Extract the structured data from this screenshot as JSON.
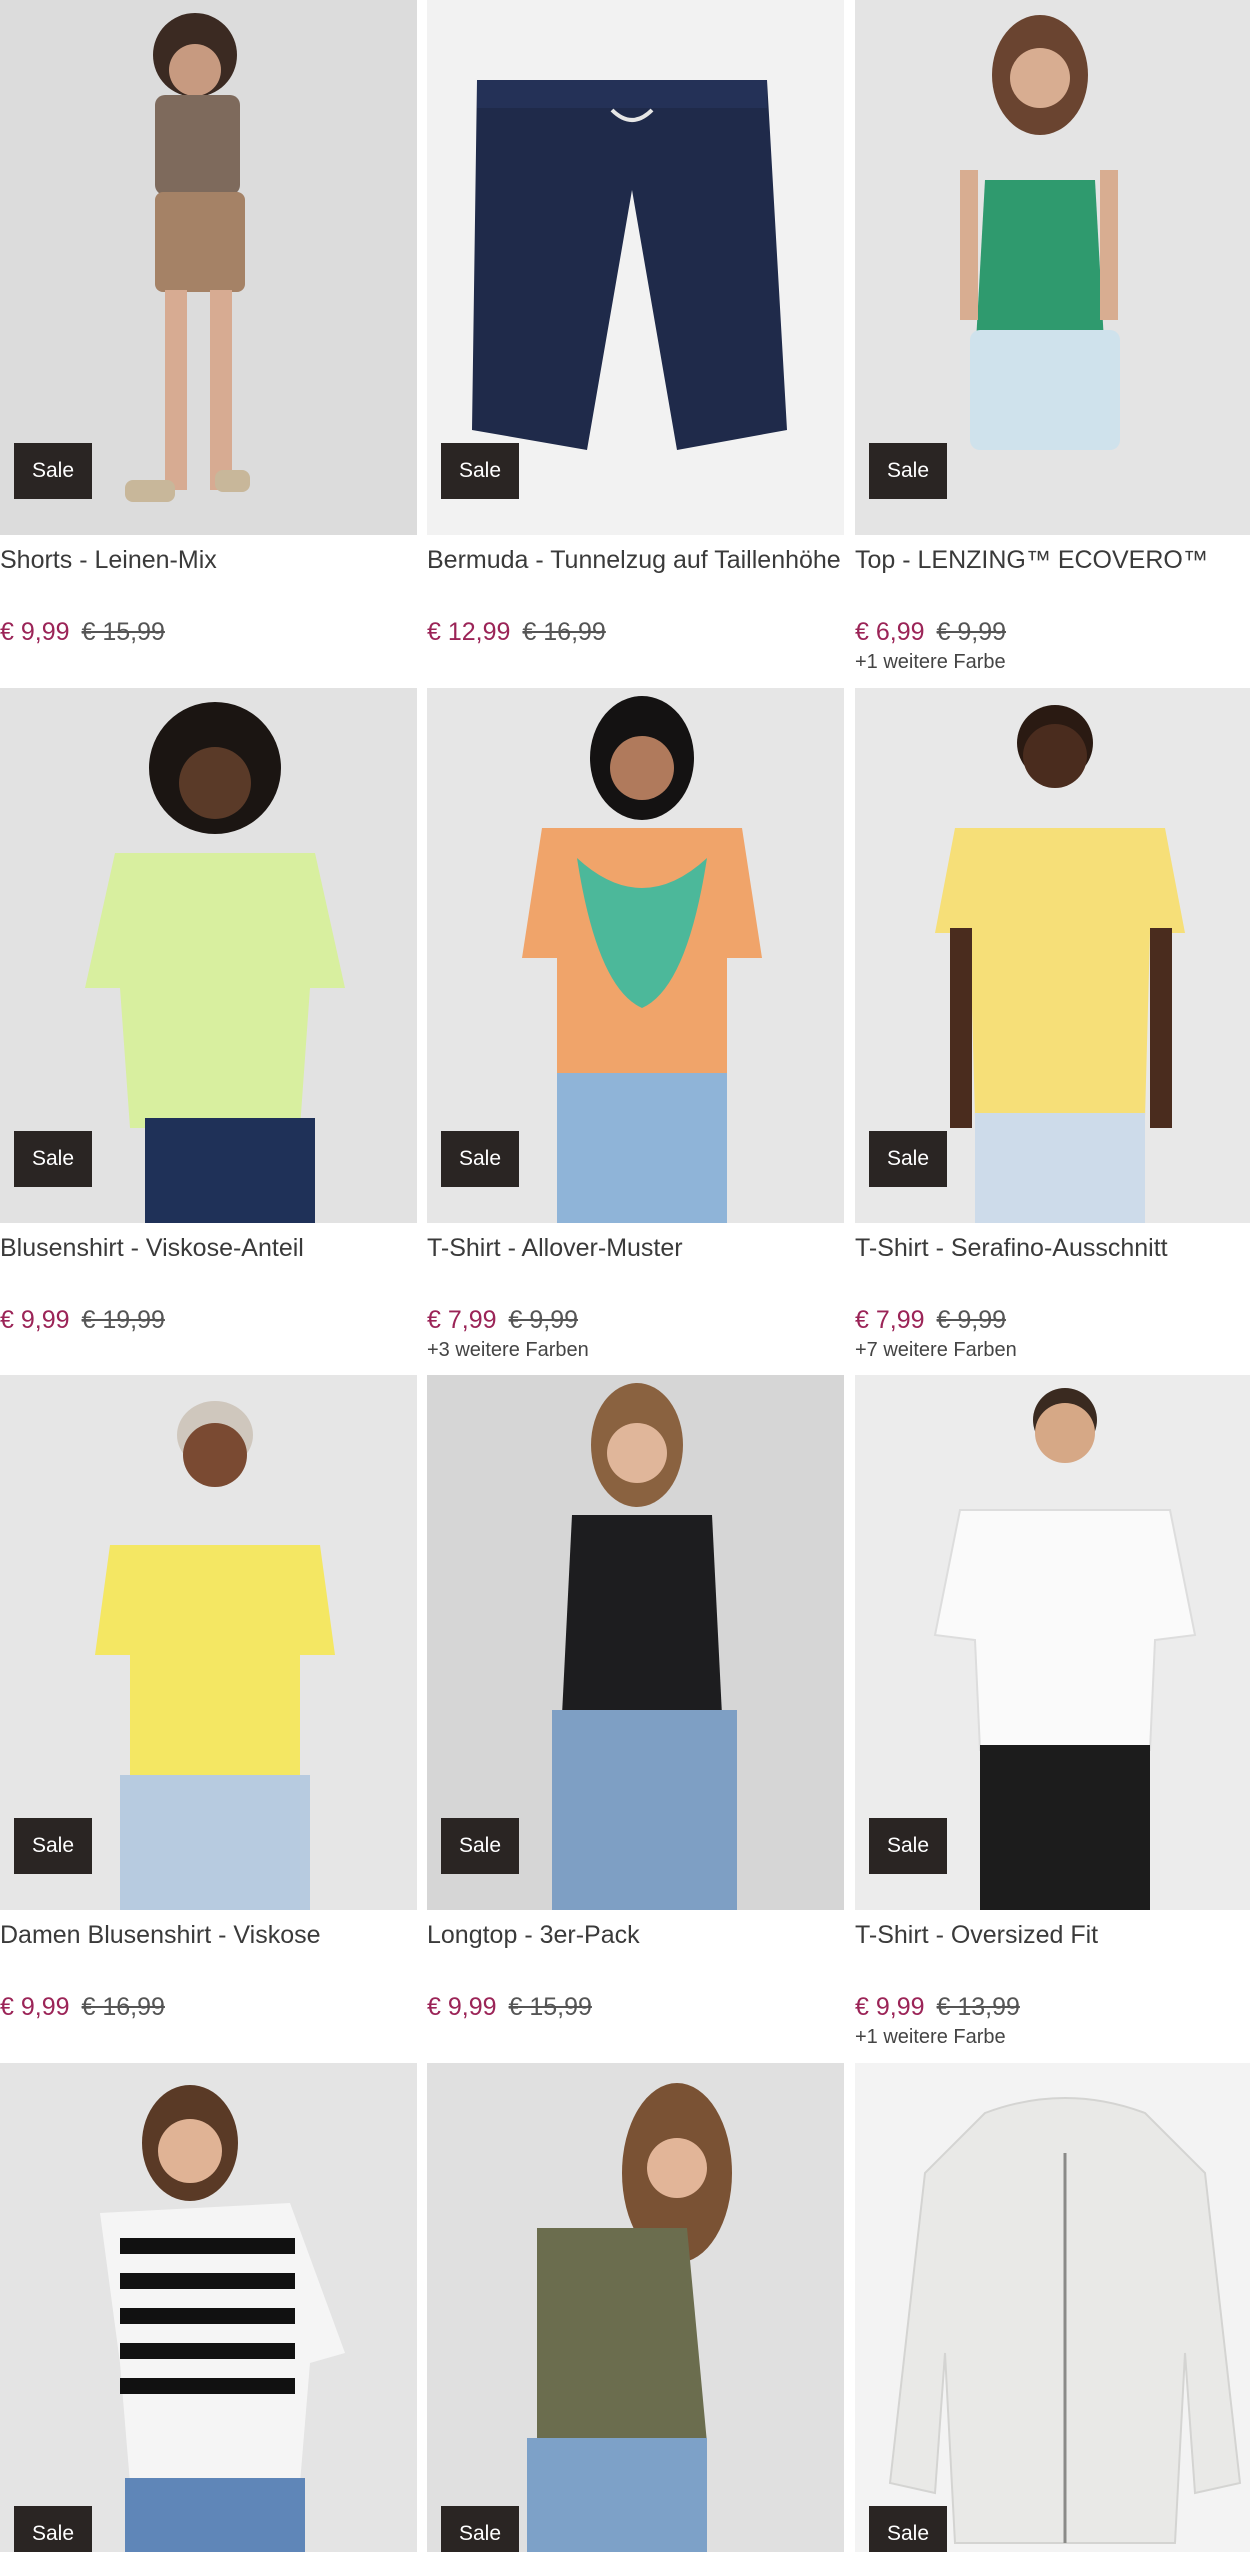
{
  "sale_label": "Sale",
  "colors": {
    "price": "#9b2457",
    "badge_bg": "#2a2523"
  },
  "products": [
    {
      "title": "Shorts - Leinen-Mix",
      "price": "€ 9,99",
      "old_price": "€ 15,99",
      "more_colors": ""
    },
    {
      "title": "Bermuda - Tunnelzug auf Taillenhöhe",
      "price": "€ 12,99",
      "old_price": "€ 16,99",
      "more_colors": ""
    },
    {
      "title": "Top - LENZING™ ECOVERO™",
      "price": "€ 6,99",
      "old_price": "€ 9,99",
      "more_colors": "+1 weitere Farbe"
    },
    {
      "title": "Blusenshirt - Viskose-Anteil",
      "price": "€ 9,99",
      "old_price": "€ 19,99",
      "more_colors": ""
    },
    {
      "title": "T-Shirt - Allover-Muster",
      "price": "€ 7,99",
      "old_price": "€ 9,99",
      "more_colors": "+3 weitere Farben"
    },
    {
      "title": "T-Shirt - Serafino-Ausschnitt",
      "price": "€ 7,99",
      "old_price": "€ 9,99",
      "more_colors": "+7 weitere Farben"
    },
    {
      "title": "Damen Blusenshirt - Viskose",
      "price": "€ 9,99",
      "old_price": "€ 16,99",
      "more_colors": ""
    },
    {
      "title": "Longtop - 3er-Pack",
      "price": "€ 9,99",
      "old_price": "€ 15,99",
      "more_colors": ""
    },
    {
      "title": "T-Shirt - Oversized Fit",
      "price": "€ 9,99",
      "old_price": "€ 13,99",
      "more_colors": "+1 weitere Farbe"
    },
    {
      "title": "",
      "price": "",
      "old_price": "",
      "more_colors": ""
    },
    {
      "title": "",
      "price": "",
      "old_price": "",
      "more_colors": ""
    },
    {
      "title": "",
      "price": "",
      "old_price": "",
      "more_colors": ""
    }
  ]
}
